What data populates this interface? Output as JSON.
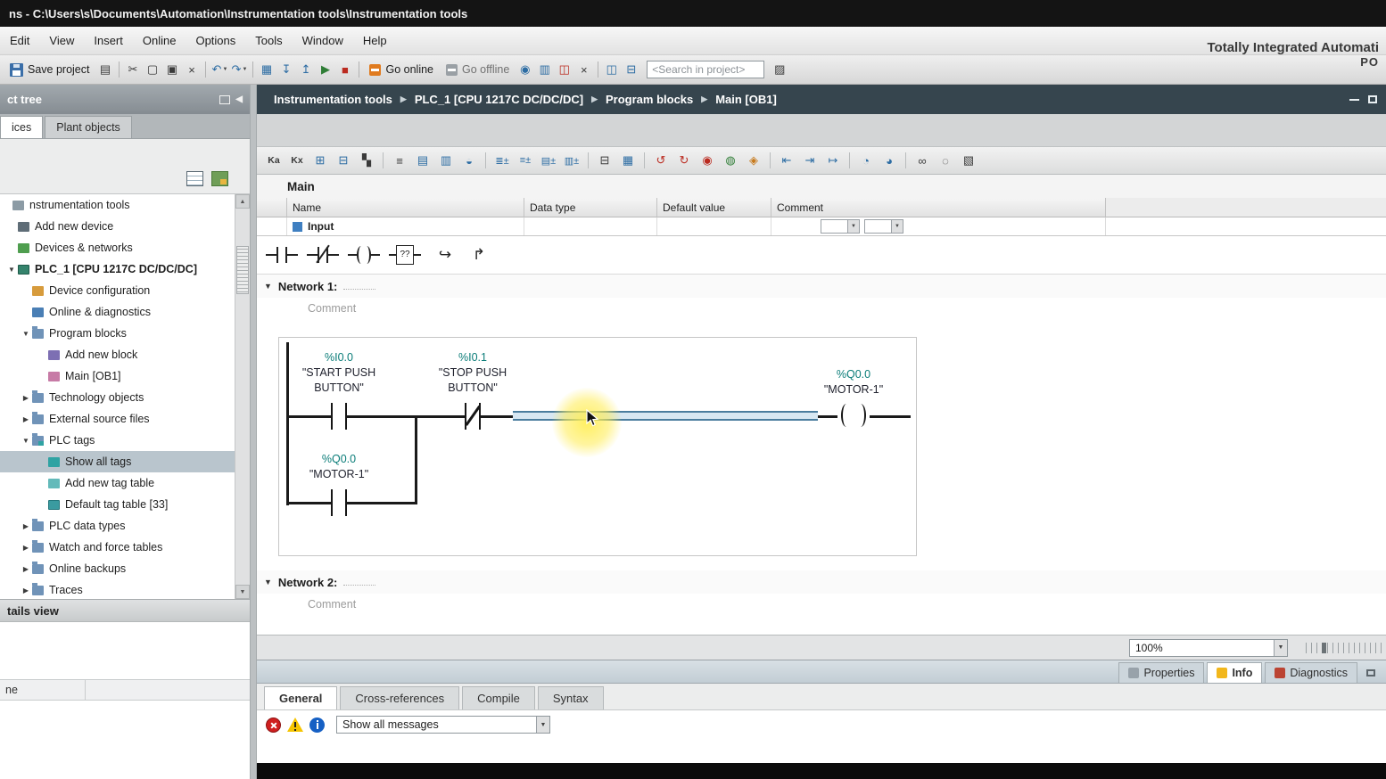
{
  "icons": {
    "caret": "▼",
    "scroll_up": "▲",
    "scroll_down": "▼",
    "collapse_left": "◀",
    "library": "▨"
  },
  "title_bar": {
    "text": "ns  -  C:\\Users\\s\\Documents\\Automation\\Instrumentation tools\\Instrumentation tools"
  },
  "menu": {
    "items": [
      {
        "label": "Edit"
      },
      {
        "label": "View"
      },
      {
        "label": "Insert"
      },
      {
        "label": "Online"
      },
      {
        "label": "Options"
      },
      {
        "label": "Tools"
      },
      {
        "label": "Window"
      },
      {
        "label": "Help"
      }
    ]
  },
  "brand": {
    "line1": "Totally Integrated Automati",
    "line2": "PO"
  },
  "toolbar": {
    "save_label": "Save project",
    "go_online": "Go online",
    "go_offline": "Go offline",
    "search_placeholder": "<Search in project>",
    "icons_a": [
      {
        "icon_name": "print-icon",
        "glyph": "▤",
        "cls": "g-dark"
      },
      {
        "cls": "sep",
        "interactable": false
      },
      {
        "icon_name": "cut-icon",
        "glyph": "✂",
        "cls": "g-dark"
      },
      {
        "icon_name": "copy-icon",
        "glyph": "▢",
        "cls": "g-dark"
      },
      {
        "icon_name": "paste-icon",
        "glyph": "▣",
        "cls": "g-dark"
      },
      {
        "icon_name": "delete-icon",
        "glyph": "×",
        "cls": "g-dark"
      },
      {
        "cls": "sep",
        "interactable": false
      },
      {
        "icon_name": "undo-icon",
        "glyph": "↶",
        "cls": "g-blue",
        "caret": "▼"
      },
      {
        "icon_name": "redo-icon",
        "glyph": "↷",
        "cls": "g-blue",
        "caret": "▼"
      },
      {
        "cls": "sep",
        "interactable": false
      },
      {
        "icon_name": "compile-icon",
        "glyph": "▦",
        "cls": "g-blue"
      },
      {
        "icon_name": "download-to-device-icon",
        "glyph": "↧",
        "cls": "g-blue"
      },
      {
        "icon_name": "upload-from-device-icon",
        "glyph": "↥",
        "cls": "g-blue"
      },
      {
        "icon_name": "start-cpu-icon",
        "glyph": "▶",
        "cls": "g-green"
      },
      {
        "icon_name": "stop-cpu-icon",
        "glyph": "■",
        "cls": "g-red"
      },
      {
        "cls": "sep",
        "interactable": false
      }
    ],
    "icons_b": [
      {
        "icon_name": "accessible-devices-icon",
        "glyph": "◉",
        "cls": "g-blue"
      },
      {
        "icon_name": "start-simulation-icon",
        "glyph": "▥",
        "cls": "g-blue"
      },
      {
        "icon_name": "compare-offline-online-icon",
        "glyph": "◫",
        "cls": "g-red"
      },
      {
        "icon_name": "cross-references-icon",
        "glyph": "×",
        "cls": "g-dark"
      },
      {
        "cls": "sep",
        "interactable": false
      },
      {
        "icon_name": "split-editor-vertical-icon",
        "glyph": "◫",
        "cls": "g-blue"
      },
      {
        "icon_name": "split-editor-horizontal-icon",
        "glyph": "⊟",
        "cls": "g-blue"
      }
    ]
  },
  "breadcrumb": {
    "items": [
      {
        "sep": "",
        "label": "Instrumentation tools"
      },
      {
        "sep": "▶",
        "label": "PLC_1 [CPU 1217C DC/DC/DC]"
      },
      {
        "sep": "▶",
        "label": "Program blocks"
      },
      {
        "sep": "▶",
        "label": "Main [OB1]"
      }
    ]
  },
  "sidebar": {
    "header": "ct tree",
    "tabs": [
      {
        "label": "ices",
        "active": true
      },
      {
        "label": "Plant objects"
      }
    ],
    "tree": [
      {
        "label": "nstrumentation tools",
        "arrow": "",
        "pad": 0,
        "icon_name": "project-icon",
        "icon_cls": "ic-proj"
      },
      {
        "label": "Add new device",
        "arrow": "",
        "pad": 6,
        "icon_name": "add-device-icon",
        "icon_cls": "ic-adddev"
      },
      {
        "label": "Devices & networks",
        "arrow": "",
        "pad": 6,
        "icon_name": "devices-networks-icon",
        "icon_cls": "ic-net"
      },
      {
        "label": "PLC_1 [CPU 1217C DC/DC/DC]",
        "arrow": "▼",
        "pad": 6,
        "icon_name": "plc-cpu-icon",
        "icon_cls": "ic-cpu",
        "cls": "bold"
      },
      {
        "label": "Device configuration",
        "arrow": "",
        "pad": 22,
        "icon_name": "device-configuration-icon",
        "icon_cls": "ic-devconf"
      },
      {
        "label": "Online & diagnostics",
        "arrow": "",
        "pad": 22,
        "icon_name": "online-diagnostics-icon",
        "icon_cls": "ic-diag"
      },
      {
        "label": "Program blocks",
        "arrow": "▼",
        "pad": 22,
        "icon_name": "folder-icon",
        "icon_cls": "ic-folder"
      },
      {
        "label": "Add new block",
        "arrow": "",
        "pad": 40,
        "icon_name": "add-block-icon",
        "icon_cls": "ic-addblock"
      },
      {
        "label": "Main [OB1]",
        "arrow": "",
        "pad": 40,
        "icon_name": "ob-block-icon",
        "icon_cls": "ic-ob"
      },
      {
        "label": "Technology objects",
        "arrow": "▶",
        "pad": 22,
        "icon_name": "folder-icon",
        "icon_cls": "ic-folder"
      },
      {
        "label": "External source files",
        "arrow": "▶",
        "pad": 22,
        "icon_name": "folder-icon",
        "icon_cls": "ic-folder"
      },
      {
        "label": "PLC tags",
        "arrow": "▼",
        "pad": 22,
        "icon_name": "tags-folder-icon",
        "icon_cls": "ic-tagfolder"
      },
      {
        "label": "Show all tags",
        "arrow": "",
        "pad": 40,
        "icon_name": "tag-table-icon",
        "icon_cls": "ic-tag",
        "selected": true
      },
      {
        "label": "Add new tag table",
        "arrow": "",
        "pad": 40,
        "icon_name": "add-tag-table-icon",
        "icon_cls": "ic-addtag"
      },
      {
        "label": "Default tag table [33]",
        "arrow": "",
        "pad": 40,
        "icon_name": "default-tag-table-icon",
        "icon_cls": "ic-tagtable"
      },
      {
        "label": "PLC data types",
        "arrow": "▶",
        "pad": 22,
        "icon_name": "folder-icon",
        "icon_cls": "ic-folder"
      },
      {
        "label": "Watch and force tables",
        "arrow": "▶",
        "pad": 22,
        "icon_name": "folder-icon",
        "icon_cls": "ic-folder"
      },
      {
        "label": "Online backups",
        "arrow": "▶",
        "pad": 22,
        "icon_name": "folder-icon",
        "icon_cls": "ic-folder"
      },
      {
        "label": "Traces",
        "arrow": "▶",
        "pad": 22,
        "icon_name": "folder-icon",
        "icon_cls": "ic-folder"
      }
    ],
    "details_header": "tails view",
    "details_column": "ne"
  },
  "editor": {
    "title": "Main",
    "lad_toolbar": [
      {
        "icon_name": "absolute-operands-icon",
        "glyph": "Ka",
        "cls": "c-dark txt"
      },
      {
        "icon_name": "symbolic-operands-icon",
        "glyph": "Kx",
        "cls": "c-dark txt"
      },
      {
        "icon_name": "insert-row-icon",
        "glyph": "⊞",
        "cls": "c-blue"
      },
      {
        "icon_name": "add-row-icon",
        "glyph": "⊟",
        "cls": "c-blue"
      },
      {
        "icon_name": "insert-connection-icon",
        "glyph": "▚",
        "cls": "c-dark"
      },
      {
        "cls": "sep",
        "interactable": false
      },
      {
        "icon_name": "align-rows-icon",
        "glyph": "≡",
        "cls": "c-dark"
      },
      {
        "icon_name": "split-columns-icon",
        "glyph": "▤",
        "cls": "c-blue"
      },
      {
        "icon_name": "merge-columns-icon",
        "glyph": "▥",
        "cls": "c-blue"
      },
      {
        "icon_name": "comment-toggle-icon",
        "glyph": "◒",
        "cls": "c-blue"
      },
      {
        "cls": "sep",
        "interactable": false
      },
      {
        "icon_name": "expand-networks-icon",
        "glyph": "≣±",
        "cls": "c-blue sm"
      },
      {
        "icon_name": "collapse-networks-icon",
        "glyph": "≡±",
        "cls": "c-blue sm"
      },
      {
        "icon_name": "open-comments-icon",
        "glyph": "▤±",
        "cls": "c-blue sm"
      },
      {
        "icon_name": "close-comments-icon",
        "glyph": "▥±",
        "cls": "c-blue sm"
      },
      {
        "cls": "sep",
        "interactable": false
      },
      {
        "icon_name": "favorites-toggle-icon",
        "glyph": "⊟",
        "cls": "c-dark"
      },
      {
        "icon_name": "status-display-icon",
        "glyph": "▦",
        "cls": "c-blue"
      },
      {
        "cls": "sep",
        "interactable": false
      },
      {
        "icon_name": "previous-error-icon",
        "glyph": "↺",
        "cls": "c-red"
      },
      {
        "icon_name": "next-error-icon",
        "glyph": "↻",
        "cls": "c-red"
      },
      {
        "icon_name": "goto-definition-icon",
        "glyph": "◉",
        "cls": "c-red"
      },
      {
        "icon_name": "update-block-calls-icon",
        "glyph": "◍",
        "cls": "c-green"
      },
      {
        "icon_name": "consistency-check-icon",
        "glyph": "◈",
        "cls": "c-orange"
      },
      {
        "cls": "sep",
        "interactable": false
      },
      {
        "icon_name": "jump-to-start-icon",
        "glyph": "⇤",
        "cls": "c-blue"
      },
      {
        "icon_name": "edit-absolute-icon",
        "glyph": "⇥",
        "cls": "c-blue"
      },
      {
        "icon_name": "free-form-comment-icon",
        "glyph": "↦",
        "cls": "c-blue"
      },
      {
        "cls": "sep",
        "interactable": false
      },
      {
        "icon_name": "monitoring-on-icon",
        "glyph": "◔",
        "cls": "c-blue"
      },
      {
        "icon_name": "monitoring-off-icon",
        "glyph": "◕",
        "cls": "c-blue"
      },
      {
        "cls": "sep",
        "interactable": false
      },
      {
        "icon_name": "call-structure-icon",
        "glyph": "∞",
        "cls": "c-dark"
      },
      {
        "icon_name": "snapshot-icon",
        "glyph": "◌",
        "cls": "c-dark"
      },
      {
        "icon_name": "library-icon",
        "glyph": "▧",
        "cls": "c-dark"
      }
    ],
    "interface_table": {
      "headers": [
        {
          "label": "",
          "cls": "col-gutter",
          "interactable": false
        },
        {
          "label": "Name",
          "cls": "col-name"
        },
        {
          "label": "Data type",
          "cls": "col-datatype"
        },
        {
          "label": "Default value",
          "cls": "col-default"
        },
        {
          "label": "Comment",
          "cls": "col-comment"
        }
      ],
      "partial_row_label": "Input"
    },
    "favorites_box_glyph": "??",
    "open_branch_glyph": "↪",
    "close_branch_glyph": "↱",
    "networks": [
      {
        "arrow": "▼",
        "label": "Network 1:",
        "comment": "Comment"
      },
      {
        "arrow": "▼",
        "label": "Network 2:",
        "comment": "Comment"
      }
    ],
    "ladder": {
      "contact1_address": "%I0.0",
      "contact1_name": "\"START PUSH BUTTON\"",
      "contact2_address": "%I0.1",
      "contact2_name": "\"STOP PUSH BUTTON\"",
      "coil_address": "%Q0.0",
      "coil_name": "\"MOTOR-1\"",
      "branch_address": "%Q0.0",
      "branch_name": "\"MOTOR-1\""
    },
    "zoom_value": "100%"
  },
  "bottom_panel": {
    "tabs_right": [
      {
        "label": "Properties",
        "icon_name": "properties-icon",
        "icon_cls": "pt-prop"
      },
      {
        "label": "Info",
        "active": true,
        "icon_name": "info-icon",
        "icon_cls": "pt-info"
      },
      {
        "label": "Diagnostics",
        "icon_name": "diagnostics-icon",
        "icon_cls": "pt-diag"
      }
    ],
    "tabs": [
      {
        "label": "General",
        "active": true
      },
      {
        "label": "Cross-references"
      },
      {
        "label": "Compile"
      },
      {
        "label": "Syntax"
      }
    ],
    "filter_value": "Show all messages"
  }
}
